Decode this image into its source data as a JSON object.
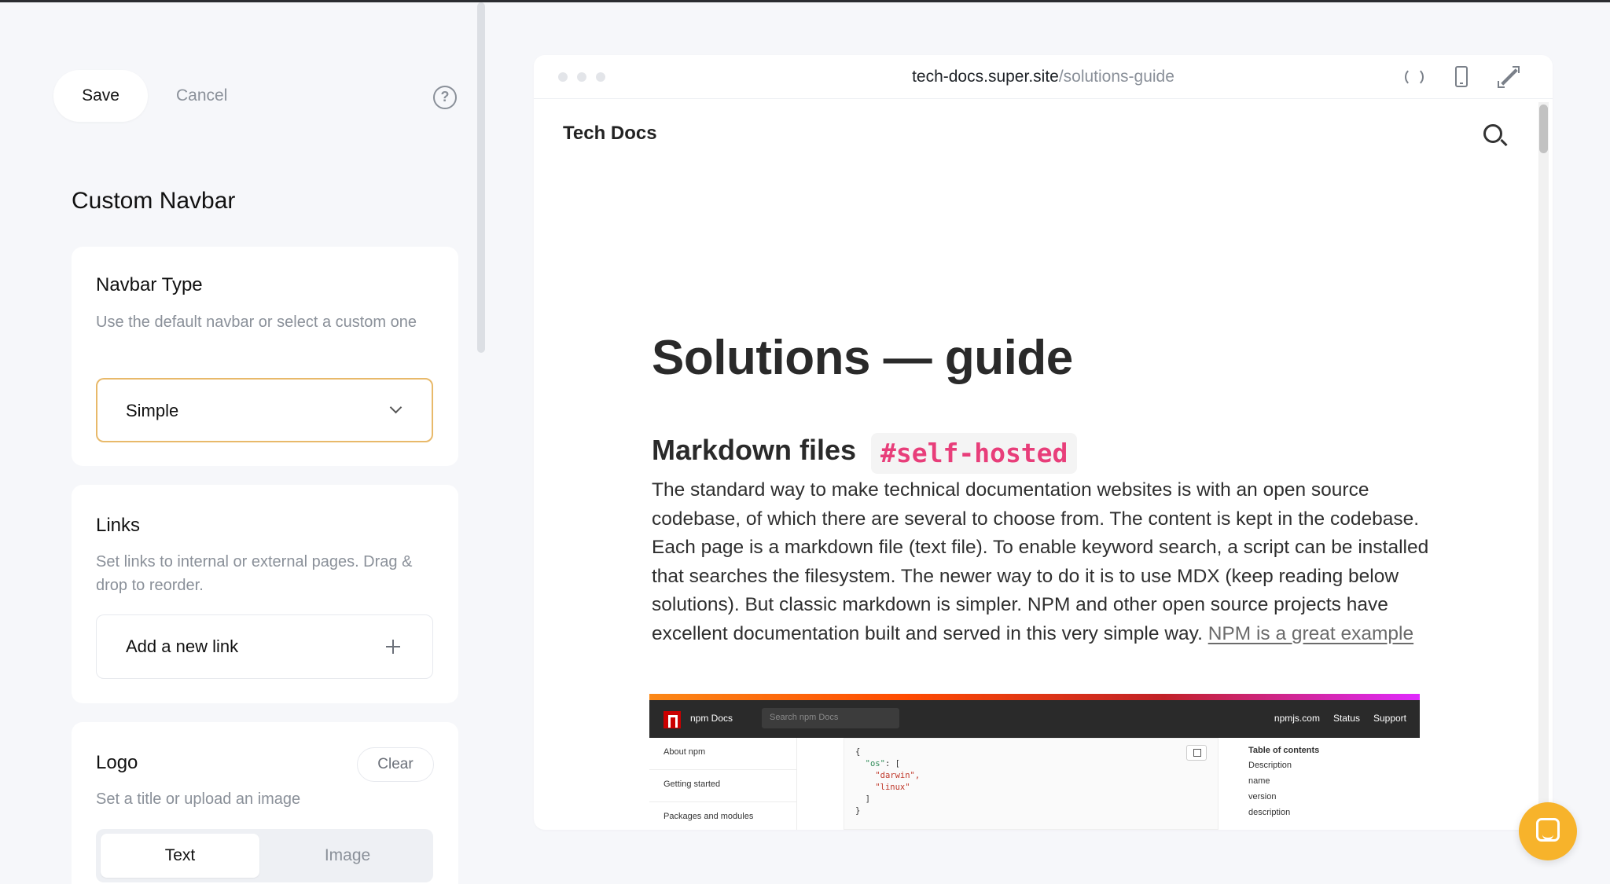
{
  "toolbar": {
    "save_label": "Save",
    "cancel_label": "Cancel"
  },
  "panel": {
    "title": "Custom Navbar",
    "navbar_type": {
      "title": "Navbar Type",
      "description": "Use the default navbar or select a custom one",
      "selected": "Simple"
    },
    "links": {
      "title": "Links",
      "description": "Set links to internal or external pages. Drag & drop to reorder.",
      "add_label": "Add a new link"
    },
    "logo": {
      "title": "Logo",
      "clear_label": "Clear",
      "description": "Set a title or upload an image",
      "options": [
        "Text",
        "Image"
      ]
    }
  },
  "preview": {
    "url_host": "tech-docs.super.site",
    "url_path": "/solutions-guide",
    "site_title": "Tech Docs",
    "heading": "Solutions — guide",
    "section_heading": "Markdown files",
    "tag": "#self-hosted",
    "paragraph": "The standard way to make technical documentation websites is with an open source codebase, of which there are several to choose from. The content is kept in the codebase. Each page is a markdown file (text file). To enable keyword search, a script can be installed that searches the filesystem. The newer way to do it is to use MDX (keep reading below solutions). But classic markdown is simpler. NPM and other open source projects have excellent documentation built and served in this very simple way.",
    "link_text": "NPM is a great example",
    "npm": {
      "brand": "npm Docs",
      "search_placeholder": "Search npm Docs",
      "nav_links": [
        "npmjs.com",
        "Status",
        "Support"
      ],
      "sidebar": [
        "About npm",
        "Getting started",
        "Packages and modules"
      ],
      "code_open": "{",
      "code_key": "\"os\"",
      "code_colon": ": [",
      "code_v1": "\"darwin\",",
      "code_v2": "\"linux\"",
      "code_close_arr": "]",
      "code_close": "}",
      "toc_title": "Table of contents",
      "toc": [
        "Description",
        "name",
        "version",
        "description"
      ]
    }
  },
  "colors": {
    "accent": "#e8b96a",
    "chat": "#f7b32b",
    "tag": "#e83e7a"
  }
}
